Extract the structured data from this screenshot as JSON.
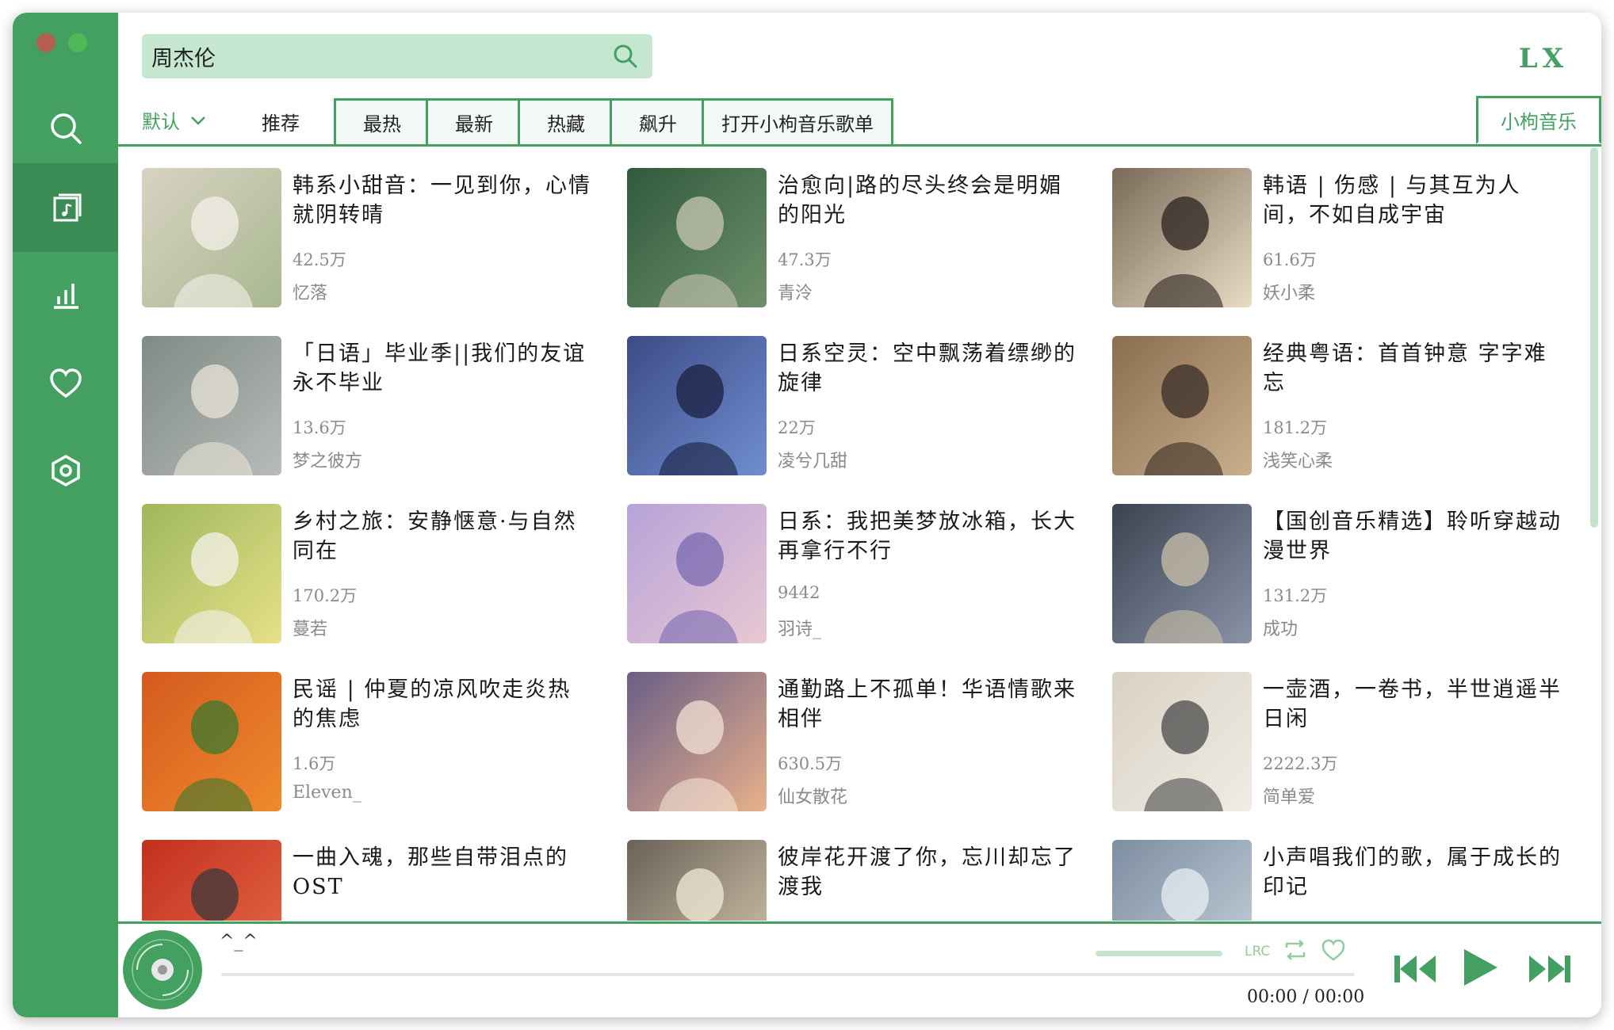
{
  "app": {
    "logo": "LX",
    "search_value": "周杰伦",
    "colors": {
      "accent": "#44a061",
      "accent_dark": "#3a8c54",
      "search_bg": "#c5e6cf"
    }
  },
  "sidebar": {
    "items": [
      {
        "icon": "search-icon",
        "active": false
      },
      {
        "icon": "song-list-icon",
        "active": true
      },
      {
        "icon": "leaderboard-icon",
        "active": false
      },
      {
        "icon": "heart-icon",
        "active": false
      },
      {
        "icon": "settings-icon",
        "active": false
      }
    ]
  },
  "tabs": {
    "sort_label": "默认",
    "items": [
      "推荐",
      "最热",
      "最新",
      "热藏",
      "飙升",
      "打开小枸音乐歌单"
    ],
    "source_label": "小枸音乐"
  },
  "playlists": [
    {
      "title": "韩系小甜音：一见到你，心情就阴转晴",
      "plays": "42.5万",
      "author": "忆落"
    },
    {
      "title": "治愈向|路的尽头终会是明媚的阳光",
      "plays": "47.3万",
      "author": "青泠"
    },
    {
      "title": "韩语 | 伤感 | 与其互为人间，不如自成宇宙",
      "plays": "61.6万",
      "author": "妖小柔"
    },
    {
      "title": "「日语」毕业季||我们的友谊永不毕业",
      "plays": "13.6万",
      "author": "梦之彼方"
    },
    {
      "title": "日系空灵：空中飘荡着缥缈的旋律",
      "plays": "22万",
      "author": "凌兮几甜"
    },
    {
      "title": "经典粤语：首首钟意 字字难忘",
      "plays": "181.2万",
      "author": "浅笑心柔"
    },
    {
      "title": "乡村之旅：安静惬意·与自然同在",
      "plays": "170.2万",
      "author": "蔓若"
    },
    {
      "title": "日系：我把美梦放冰箱，长大再拿行不行",
      "plays": "9442",
      "author": "羽诗_"
    },
    {
      "title": "【国创音乐精选】聆听穿越动漫世界",
      "plays": "131.2万",
      "author": "成功"
    },
    {
      "title": "民谣 | 仲夏的凉风吹走炎热的焦虑",
      "plays": "1.6万",
      "author": "Eleven_"
    },
    {
      "title": "通勤路上不孤单！华语情歌来相伴",
      "plays": "630.5万",
      "author": "仙女散花"
    },
    {
      "title": "一壶酒，一卷书，半世逍遥半日闲",
      "plays": "2222.3万",
      "author": "简单爱"
    },
    {
      "title": "一曲入魂，那些自带泪点的OST",
      "plays": "",
      "author": ""
    },
    {
      "title": "彼岸花开渡了你，忘川却忘了渡我",
      "plays": "",
      "author": ""
    },
    {
      "title": "小声唱我们的歌，属于成长的印记",
      "plays": "",
      "author": ""
    }
  ],
  "player": {
    "song_name": "^_^",
    "time_current": "00:00",
    "time_separator": "/",
    "time_total": "00:00",
    "lyric_label": "LRC",
    "progress": 0
  }
}
